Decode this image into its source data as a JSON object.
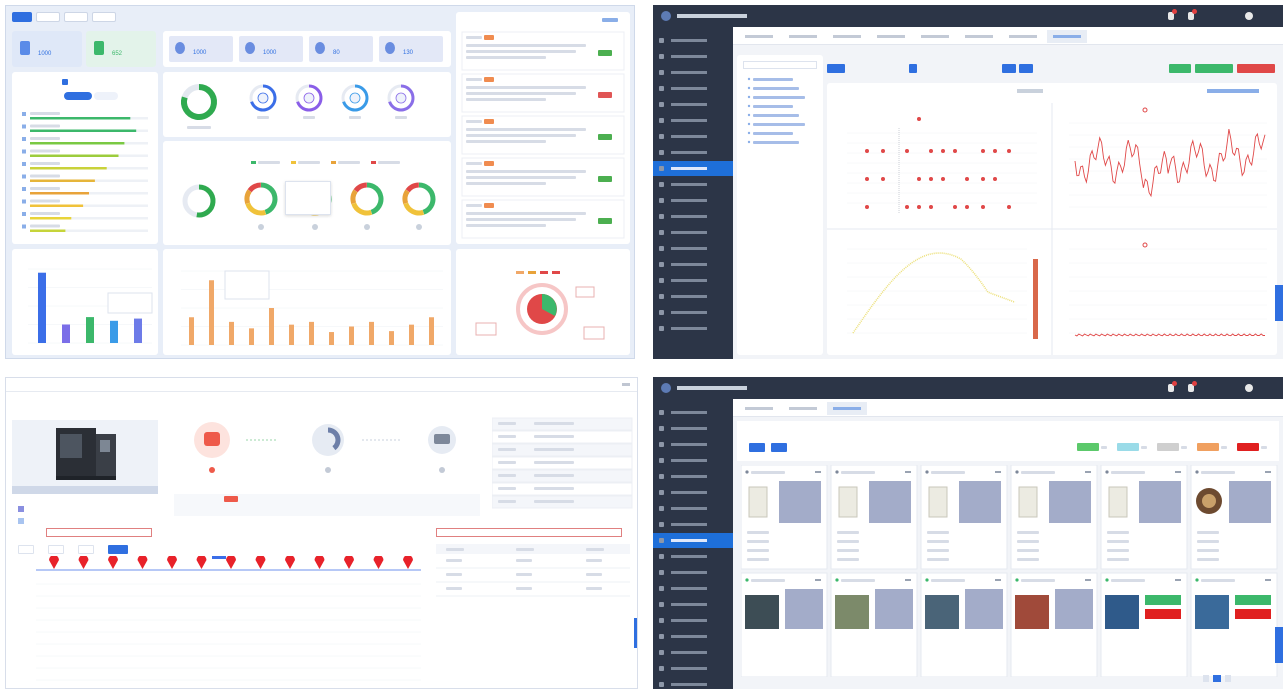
{
  "q1": {
    "tabs": [
      "",
      "",
      "",
      ""
    ],
    "kpi_small": [
      {
        "label": "",
        "value": "1000"
      },
      {
        "label": "",
        "value": "652"
      }
    ],
    "kpi_large": [
      {
        "label": "",
        "value": "1000"
      },
      {
        "label": "",
        "value": "1000"
      },
      {
        "label": "",
        "value": "80"
      },
      {
        "label": "",
        "value": "130"
      }
    ],
    "donut_big_pct": "",
    "ring_labels": [
      "",
      "",
      "",
      ""
    ],
    "legend_items": [
      "",
      "",
      "",
      ""
    ],
    "tooltip_lines": [
      "",
      "",
      "",
      ""
    ],
    "notice_items": [
      {
        "tag_color": "#f08c50",
        "status_color": "#4caf50"
      },
      {
        "tag_color": "#f08c50",
        "status_color": "#e05555"
      },
      {
        "tag_color": "#f08c50",
        "status_color": "#4caf50"
      },
      {
        "tag_color": "#f08c50",
        "status_color": "#4caf50"
      },
      {
        "tag_color": "#f08c50",
        "status_color": "#4caf50"
      }
    ],
    "bar_values": [
      95,
      25,
      35,
      30,
      33
    ],
    "bar_colors": [
      "#3b6ee8",
      "#7b6ee8",
      "#3cb86b",
      "#3a9be8",
      "#6d7be8"
    ],
    "orange_bars": [
      30,
      70,
      25,
      18,
      40,
      22,
      25,
      14,
      20,
      25,
      15,
      22,
      30
    ],
    "progress_rows": [
      0.85,
      0.9,
      0.8,
      0.75,
      0.65,
      0.55,
      0.5,
      0.45,
      0.35,
      0.3
    ],
    "accent": "#2f6fe0"
  },
  "q2": {
    "title": "",
    "tabs": [
      "",
      "",
      "",
      "",
      "",
      "",
      "",
      ""
    ],
    "nav": [
      "",
      "",
      "",
      "",
      "",
      "",
      "",
      "",
      "",
      "",
      "",
      "",
      "",
      "",
      "",
      "",
      "",
      "",
      ""
    ],
    "panel_title": "",
    "panel_date": "",
    "chart_titles": [
      "",
      "",
      "",
      ""
    ],
    "buttons": {
      "green": "",
      "green2": "",
      "red": ""
    },
    "tree_items": [
      "",
      "",
      "",
      "",
      "",
      "",
      "",
      ""
    ]
  },
  "q3": {
    "title": "",
    "machine_caption": "",
    "legend": [
      "",
      "",
      ""
    ],
    "info_rows": [
      "",
      "",
      "",
      "",
      "",
      "",
      ""
    ],
    "alert_text_left": "",
    "alert_text_right": "",
    "mode_buttons": [
      "",
      "",
      "",
      ""
    ],
    "marker_count": 13,
    "table_headers": [
      "",
      "",
      ""
    ]
  },
  "q4": {
    "title": "",
    "tabs": [
      "",
      "",
      ""
    ],
    "filter_buttons": [
      "",
      ""
    ],
    "legend_colors": [
      "#5cc96b",
      "#9adbe8",
      "#cfcfcf",
      "#f0a060",
      "#e02020"
    ],
    "cards_row1": [
      "",
      "",
      "",
      "",
      "",
      ""
    ],
    "cards_row2": [
      "",
      "",
      "",
      "",
      "",
      ""
    ],
    "pagination": [
      "",
      "1",
      ""
    ]
  }
}
